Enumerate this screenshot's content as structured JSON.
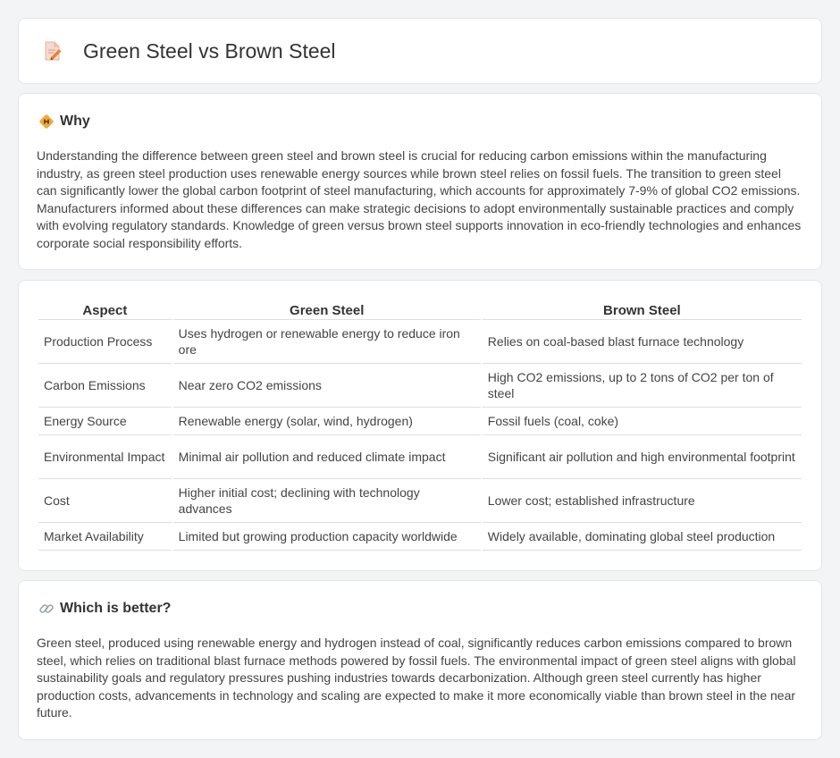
{
  "header": {
    "title": "Green Steel vs Brown Steel",
    "icon": "document-pencil-icon"
  },
  "why": {
    "heading": "Why",
    "icon": "diamond-warning-icon",
    "text": "Understanding the difference between green steel and brown steel is crucial for reducing carbon emissions within the manufacturing industry, as green steel production uses renewable energy sources while brown steel relies on fossil fuels. The transition to green steel can significantly lower the global carbon footprint of steel manufacturing, which accounts for approximately 7-9% of global CO2 emissions. Manufacturers informed about these differences can make strategic decisions to adopt environmentally sustainable practices and comply with evolving regulatory standards. Knowledge of green versus brown steel supports innovation in eco-friendly technologies and enhances corporate social responsibility efforts."
  },
  "table": {
    "headers": [
      "Aspect",
      "Green Steel",
      "Brown Steel"
    ],
    "rows": [
      [
        "Production Process",
        "Uses hydrogen or renewable energy to reduce iron ore",
        "Relies on coal-based blast furnace technology"
      ],
      [
        "Carbon Emissions",
        "Near zero CO2 emissions",
        "High CO2 emissions, up to 2 tons of CO2 per ton of steel"
      ],
      [
        "Energy Source",
        "Renewable energy (solar, wind, hydrogen)",
        "Fossil fuels (coal, coke)"
      ],
      [
        "Environmental Impact",
        "Minimal air pollution and reduced climate impact",
        "Significant air pollution and high environmental footprint"
      ],
      [
        "Cost",
        "Higher initial cost; declining with technology advances",
        "Lower cost; established infrastructure"
      ],
      [
        "Market Availability",
        "Limited but growing production capacity worldwide",
        "Widely available, dominating global steel production"
      ]
    ]
  },
  "better": {
    "heading": "Which is better?",
    "icon": "link-icon",
    "text": "Green steel, produced using renewable energy and hydrogen instead of coal, significantly reduces carbon emissions compared to brown steel, which relies on traditional blast furnace methods powered by fossil fuels. The environmental impact of green steel aligns with global sustainability goals and regulatory pressures pushing industries towards decarbonization. Although green steel currently has higher production costs, advancements in technology and scaling are expected to make it more economically viable than brown steel in the near future."
  },
  "colors": {
    "background": "#f3f4f6",
    "card": "#ffffff",
    "text": "#333333",
    "border": "#dcdfe3",
    "accent_icon": "#e8833a"
  }
}
